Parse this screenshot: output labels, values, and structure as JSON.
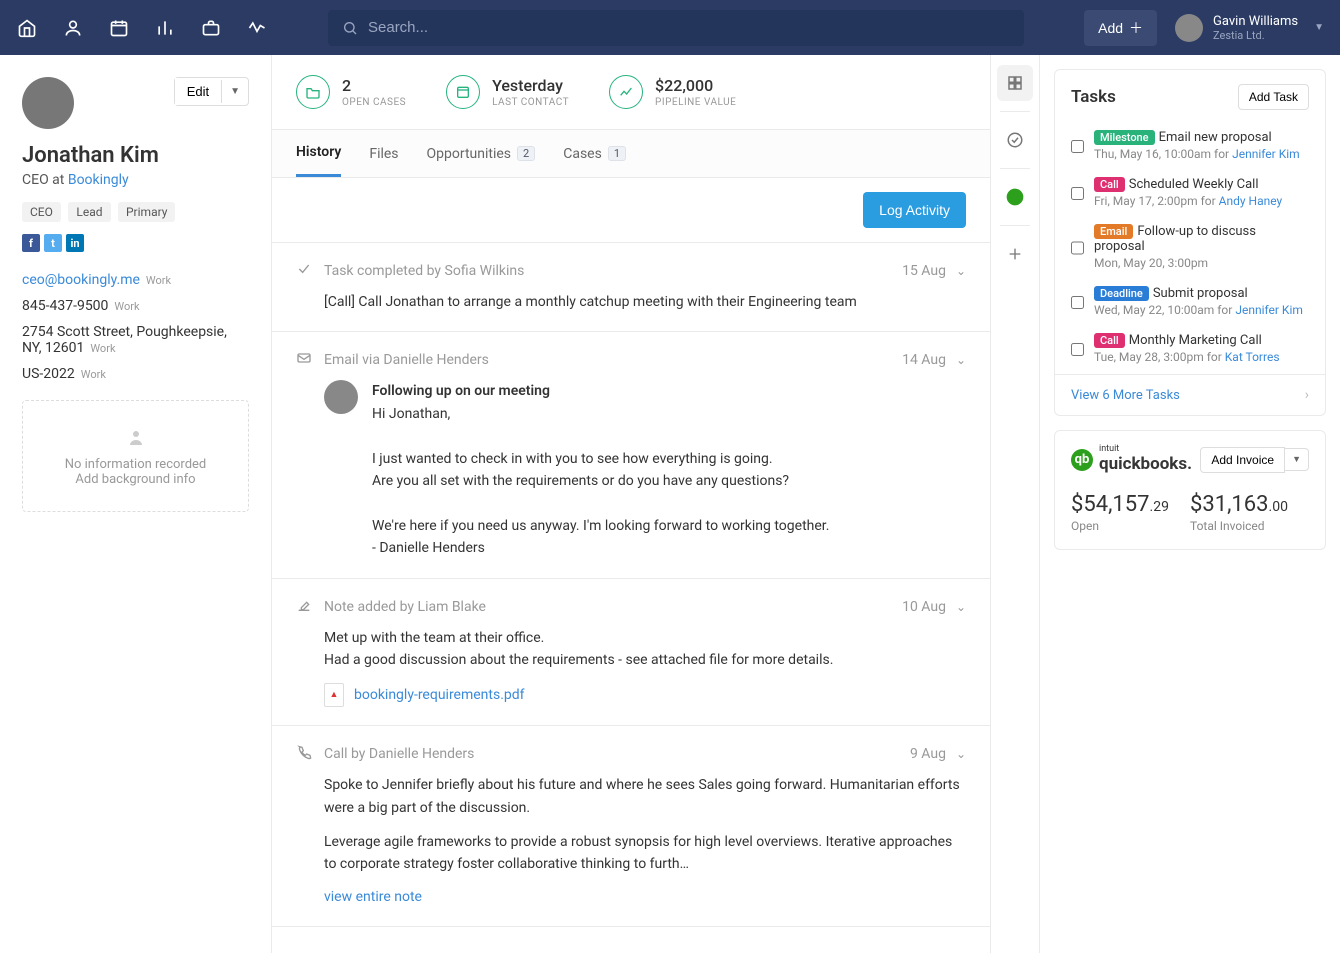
{
  "topbar": {
    "search_placeholder": "Search...",
    "add_label": "Add",
    "user_name": "Gavin Williams",
    "user_org": "Zestia Ltd."
  },
  "contact": {
    "name": "Jonathan Kim",
    "role_prefix": "CEO at ",
    "company": "Bookingly",
    "edit_label": "Edit",
    "tags": [
      "CEO",
      "Lead",
      "Primary"
    ],
    "email": "ceo@bookingly.me",
    "email_label": "Work",
    "phone": "845-437-9500",
    "phone_label": "Work",
    "address": "2754 Scott Street, Poughkeepsie, NY, 12601",
    "address_label": "Work",
    "extra": "US-2022",
    "extra_label": "Work",
    "no_info_title": "No information recorded",
    "no_info_sub": "Add background info"
  },
  "metrics": {
    "open_cases_val": "2",
    "open_cases_lbl": "Open Cases",
    "last_contact_val": "Yesterday",
    "last_contact_lbl": "Last Contact",
    "pipeline_val": "$22,000",
    "pipeline_lbl": "Pipeline Value"
  },
  "tabs": {
    "history": "History",
    "files": "Files",
    "opportunities": "Opportunities",
    "opp_count": "2",
    "cases": "Cases",
    "cases_count": "1"
  },
  "log_activity_label": "Log Activity",
  "feed": {
    "item1_title": "Task completed by Sofia Wilkins",
    "item1_date": "15 Aug",
    "item1_body": "[Call] Call Jonathan to arrange a monthly catchup meeting with their Engineering team",
    "item2_title": "Email via Danielle Henders",
    "item2_date": "14 Aug",
    "item2_subject": "Following up on our meeting",
    "item2_l1": "Hi Jonathan,",
    "item2_l2": "I just wanted to check in with you to see how everything is going.",
    "item2_l3": "Are you all set with the requirements or do you have any questions?",
    "item2_l4": "We're here if you need us anyway. I'm looking forward to working together.",
    "item2_l5": "- Danielle Henders",
    "item3_title": "Note added by Liam Blake",
    "item3_date": "10 Aug",
    "item3_l1": "Met up with the team at their office.",
    "item3_l2": "Had a good discussion about the requirements - see attached file for more details.",
    "item3_file": "bookingly-requirements.pdf",
    "item4_title": "Call by Danielle Henders",
    "item4_date": "9 Aug",
    "item4_p1": "Spoke to Jennifer briefly about his future and where he sees Sales going forward. Humanitarian efforts were a big part of the discussion.",
    "item4_p2": "Leverage agile frameworks to provide a robust synopsis for high level overviews. Iterative approaches to corporate strategy foster collaborative thinking to furth…",
    "item4_more": "view entire note"
  },
  "tasks": {
    "heading": "Tasks",
    "add_label": "Add Task",
    "for_label": "for",
    "items": [
      {
        "badge": "Milestone",
        "bclass": "b-green",
        "title": "Email new proposal",
        "sub": "Thu, May 16, 10:00am",
        "assignee": "Jennifer Kim"
      },
      {
        "badge": "Call",
        "bclass": "b-pink",
        "title": "Scheduled Weekly Call",
        "sub": "Fri, May 17, 2:00pm",
        "assignee": "Andy Haney"
      },
      {
        "badge": "Email",
        "bclass": "b-orange",
        "title": "Follow-up to discuss proposal",
        "sub": "Mon, May 20, 3:00pm",
        "assignee": ""
      },
      {
        "badge": "Deadline",
        "bclass": "b-blue",
        "title": "Submit proposal",
        "sub": "Wed, May 22, 10:00am",
        "assignee": "Jennifer Kim"
      },
      {
        "badge": "Call",
        "bclass": "b-pink",
        "title": "Monthly Marketing Call",
        "sub": "Tue, May 28, 3:00pm",
        "assignee": "Kat Torres"
      }
    ],
    "view_more": "View 6 More Tasks"
  },
  "qb": {
    "brand_small": "intuit",
    "brand_main": "quickbooks.",
    "add_invoice": "Add Invoice",
    "open_val_big": "$54,157",
    "open_val_sm": ".29",
    "open_lbl": "Open",
    "inv_val_big": "$31,163",
    "inv_val_sm": ".00",
    "inv_lbl": "Total Invoiced"
  }
}
